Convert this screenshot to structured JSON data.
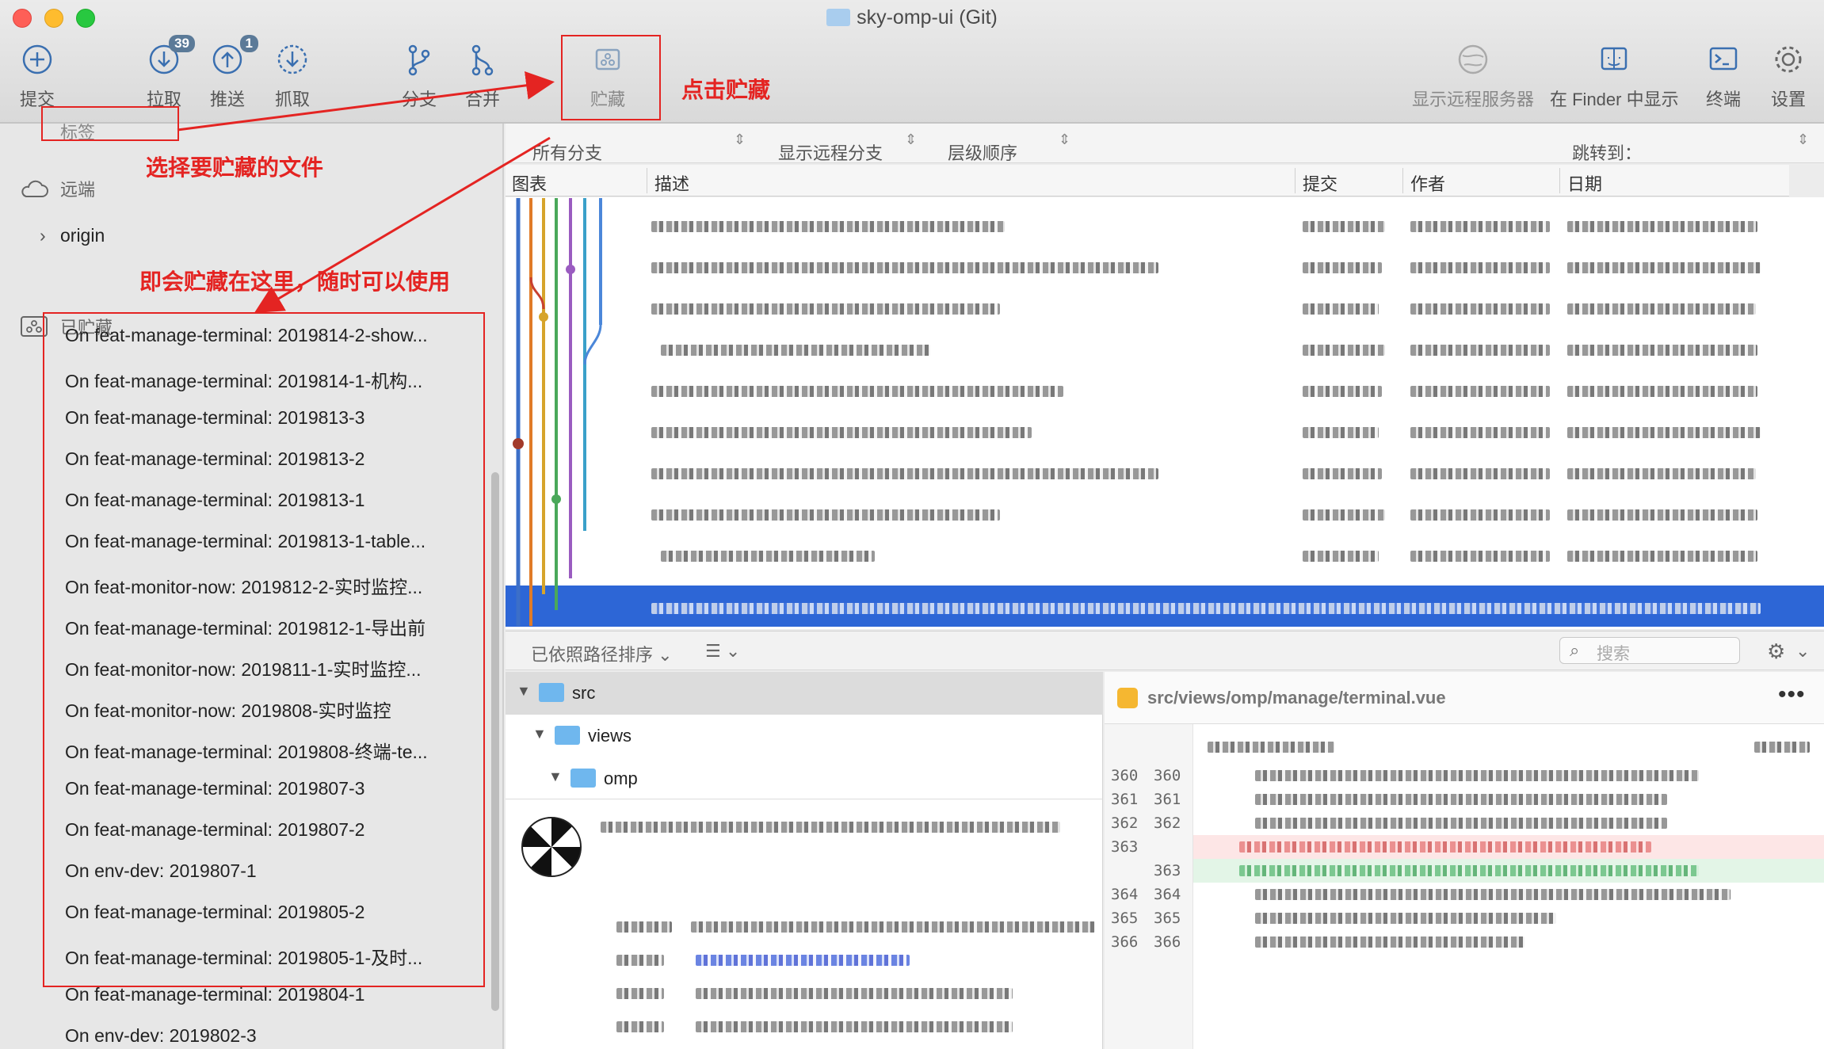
{
  "window": {
    "title": "sky-omp-ui (Git)"
  },
  "toolbar": {
    "commit": "提交",
    "pull": "拉取",
    "pull_badge": "39",
    "push": "推送",
    "push_badge": "1",
    "fetch": "抓取",
    "branch": "分支",
    "merge": "合并",
    "stash": "贮藏",
    "show_remote": "显示远程服务器",
    "show_in_finder": "在 Finder 中显示",
    "terminal": "终端",
    "settings": "设置"
  },
  "annotations": {
    "click_stash": "点击贮藏",
    "choose_files": "选择要贮藏的文件",
    "stored_here": "即会贮藏在这里，随时可以使用",
    "color": "#e42422"
  },
  "sidebar": {
    "tags_label": "标签",
    "remote_label": "远端",
    "remote_item": "origin",
    "stashes_label": "已贮藏",
    "stashes": [
      "On feat-manage-terminal: 2019814-2-show...",
      "On feat-manage-terminal: 2019814-1-机构...",
      "On feat-manage-terminal: 2019813-3",
      "On feat-manage-terminal: 2019813-2",
      "On feat-manage-terminal: 2019813-1",
      "On feat-manage-terminal: 2019813-1-table...",
      "On feat-monitor-now: 2019812-2-实时监控...",
      "On feat-manage-terminal: 2019812-1-导出前",
      "On feat-monitor-now: 2019811-1-实时监控...",
      "On feat-monitor-now: 2019808-实时监控",
      "On feat-manage-terminal: 2019808-终端-te...",
      "On feat-manage-terminal: 2019807-3",
      "On feat-manage-terminal: 2019807-2",
      "On env-dev: 2019807-1",
      "On feat-manage-terminal: 2019805-2",
      "On feat-manage-terminal: 2019805-1-及时...",
      "On feat-manage-terminal: 2019804-1",
      "On env-dev: 2019802-3"
    ]
  },
  "filter": {
    "branches": "所有分支",
    "show_remote_branches": "显示远程分支",
    "order": "层级顺序",
    "jump_to": "跳转到："
  },
  "columns": {
    "graph": "图表",
    "description": "描述",
    "commit": "提交",
    "author": "作者",
    "date": "日期"
  },
  "lower": {
    "sort": "已依照路径排序",
    "search_placeholder": "搜索"
  },
  "files": {
    "tree": [
      "src",
      "views",
      "omp"
    ]
  },
  "diff": {
    "path": "src/views/omp/manage/terminal.vue",
    "lines": [
      {
        "old": "360",
        "new": "360",
        "type": "ctx"
      },
      {
        "old": "361",
        "new": "361",
        "type": "ctx"
      },
      {
        "old": "362",
        "new": "362",
        "type": "ctx"
      },
      {
        "old": "363",
        "new": "",
        "type": "del"
      },
      {
        "old": "",
        "new": "363",
        "type": "add"
      },
      {
        "old": "364",
        "new": "364",
        "type": "ctx"
      },
      {
        "old": "365",
        "new": "365",
        "type": "ctx"
      },
      {
        "old": "366",
        "new": "366",
        "type": "ctx"
      }
    ]
  }
}
